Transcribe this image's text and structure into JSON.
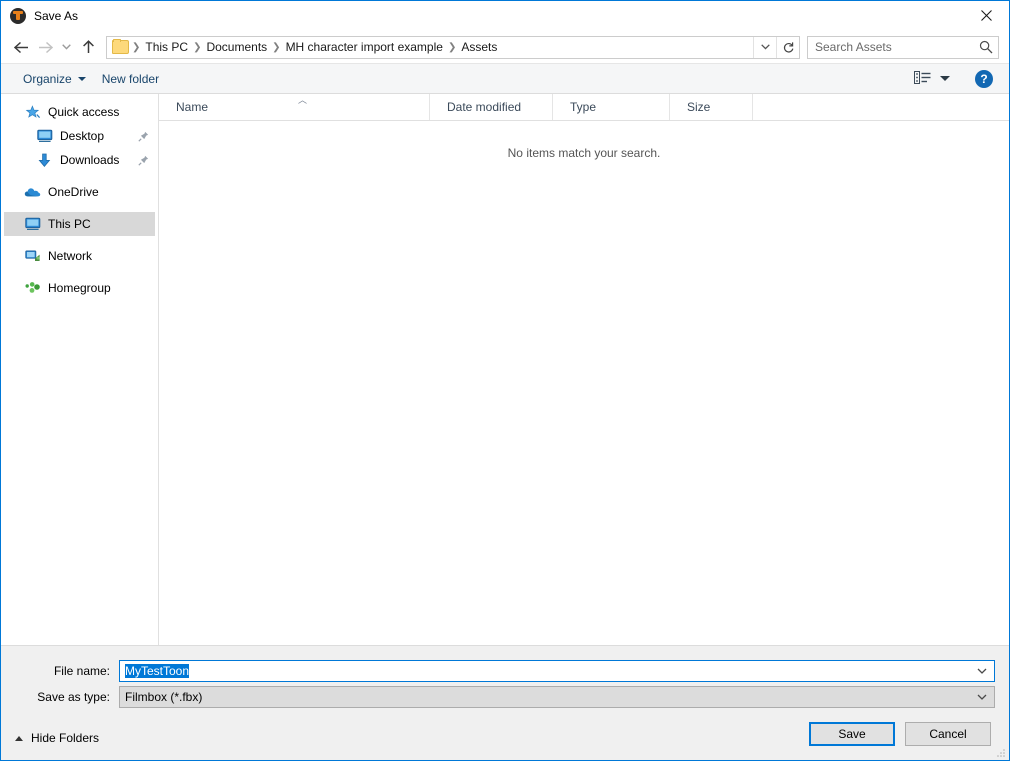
{
  "window": {
    "title": "Save As",
    "app_icon": "unreal-engine-icon",
    "close_label": "✕"
  },
  "navigation": {
    "back": "back-arrow",
    "forward": "forward-arrow",
    "recent": "recent-locations-chevron",
    "up": "up-arrow",
    "breadcrumbs": [
      "This PC",
      "Documents",
      "MH character import example",
      "Assets"
    ],
    "dropdown_icon": "chevron-down-icon",
    "refresh_icon": "refresh-icon"
  },
  "search": {
    "placeholder": "Search Assets",
    "value": "",
    "icon": "search-icon"
  },
  "toolbar": {
    "organize_label": "Organize",
    "new_folder_label": "New folder",
    "view_icon": "list-view-icon",
    "help_label": "?"
  },
  "sidebar": {
    "items": [
      {
        "label": "Quick access",
        "icon": "star-icon",
        "indent": false,
        "selected": false,
        "pinned": false,
        "gap_before": false
      },
      {
        "label": "Desktop",
        "icon": "monitor-icon",
        "indent": true,
        "selected": false,
        "pinned": true,
        "gap_before": false
      },
      {
        "label": "Downloads",
        "icon": "download-arrow-icon",
        "indent": true,
        "selected": false,
        "pinned": true,
        "gap_before": false
      },
      {
        "label": "OneDrive",
        "icon": "cloud-icon",
        "indent": false,
        "selected": false,
        "pinned": false,
        "gap_before": true
      },
      {
        "label": "This PC",
        "icon": "computer-icon",
        "indent": false,
        "selected": true,
        "pinned": false,
        "gap_before": true
      },
      {
        "label": "Network",
        "icon": "network-icon",
        "indent": false,
        "selected": false,
        "pinned": false,
        "gap_before": true
      },
      {
        "label": "Homegroup",
        "icon": "homegroup-icon",
        "indent": false,
        "selected": false,
        "pinned": false,
        "gap_before": true
      }
    ]
  },
  "filelist": {
    "columns": [
      {
        "label": "Name",
        "sorted": "asc"
      },
      {
        "label": "Date modified",
        "sorted": ""
      },
      {
        "label": "Type",
        "sorted": ""
      },
      {
        "label": "Size",
        "sorted": ""
      }
    ],
    "sort_caret": "︿",
    "empty_message": "No items match your search.",
    "rows": []
  },
  "form": {
    "filename_label": "File name:",
    "filename_value": "MyTestToon",
    "filetype_label": "Save as type:",
    "filetype_value": "Filmbox (*.fbx)",
    "selection_color": "#0078d7"
  },
  "footer": {
    "hide_folders_label": "Hide Folders",
    "save_label": "Save",
    "cancel_label": "Cancel",
    "resize_grip": "resize-grip-icon"
  }
}
